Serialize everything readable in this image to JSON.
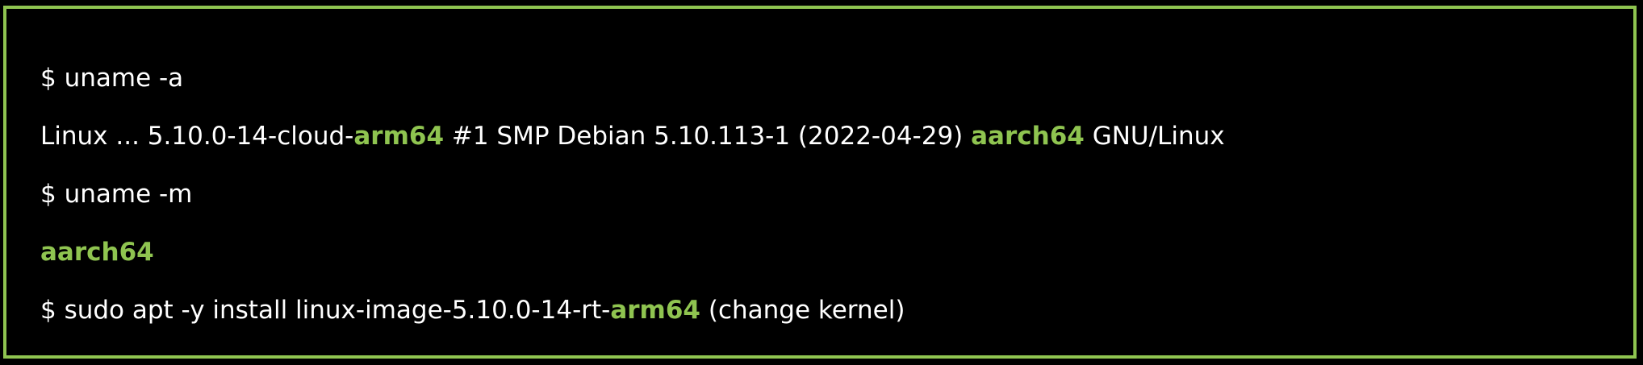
{
  "theme": {
    "background": "#000000",
    "border": "#8fc450",
    "text": "#ffffff",
    "highlight": "#8fc450"
  },
  "terminal": {
    "lines": [
      {
        "cmd": "$ uname -a"
      },
      {
        "p1": "Linux ... 5.10.0-14-cloud-",
        "h1": "arm64",
        "p2": " #1 SMP Debian 5.10.113-1 (2022-04-29) ",
        "h2": "aarch64",
        "p3": " GNU/Linux"
      },
      {
        "cmd": "$ uname -m"
      },
      {
        "h1": "aarch64"
      },
      {
        "p1": "$ sudo apt -y install linux-image-5.10.0-14-rt-",
        "h1": "arm64",
        "p2": " (change kernel)"
      }
    ]
  }
}
